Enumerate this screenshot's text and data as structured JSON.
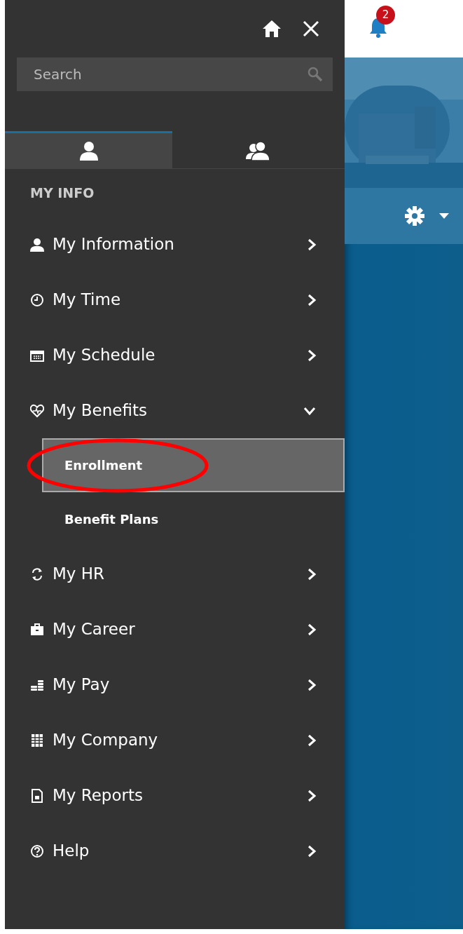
{
  "drawer": {
    "search": {
      "placeholder": "Search"
    },
    "tabs": [
      {
        "selected": true
      },
      {
        "selected": false
      }
    ],
    "section_title": "MY INFO",
    "items": [
      {
        "label": "My Information",
        "expanded": false
      },
      {
        "label": "My Time",
        "expanded": false
      },
      {
        "label": "My Schedule",
        "expanded": false
      },
      {
        "label": "My Benefits",
        "expanded": true,
        "children": [
          {
            "label": "Enrollment",
            "selected": true,
            "circled": true
          },
          {
            "label": "Benefit Plans",
            "selected": false,
            "circled": false
          }
        ]
      },
      {
        "label": "My HR",
        "expanded": false
      },
      {
        "label": "My Career",
        "expanded": false
      },
      {
        "label": "My Pay",
        "expanded": false
      },
      {
        "label": "My Company",
        "expanded": false
      },
      {
        "label": "My Reports",
        "expanded": false
      },
      {
        "label": "Help",
        "expanded": false
      }
    ]
  },
  "header": {
    "notification_count": "2"
  }
}
